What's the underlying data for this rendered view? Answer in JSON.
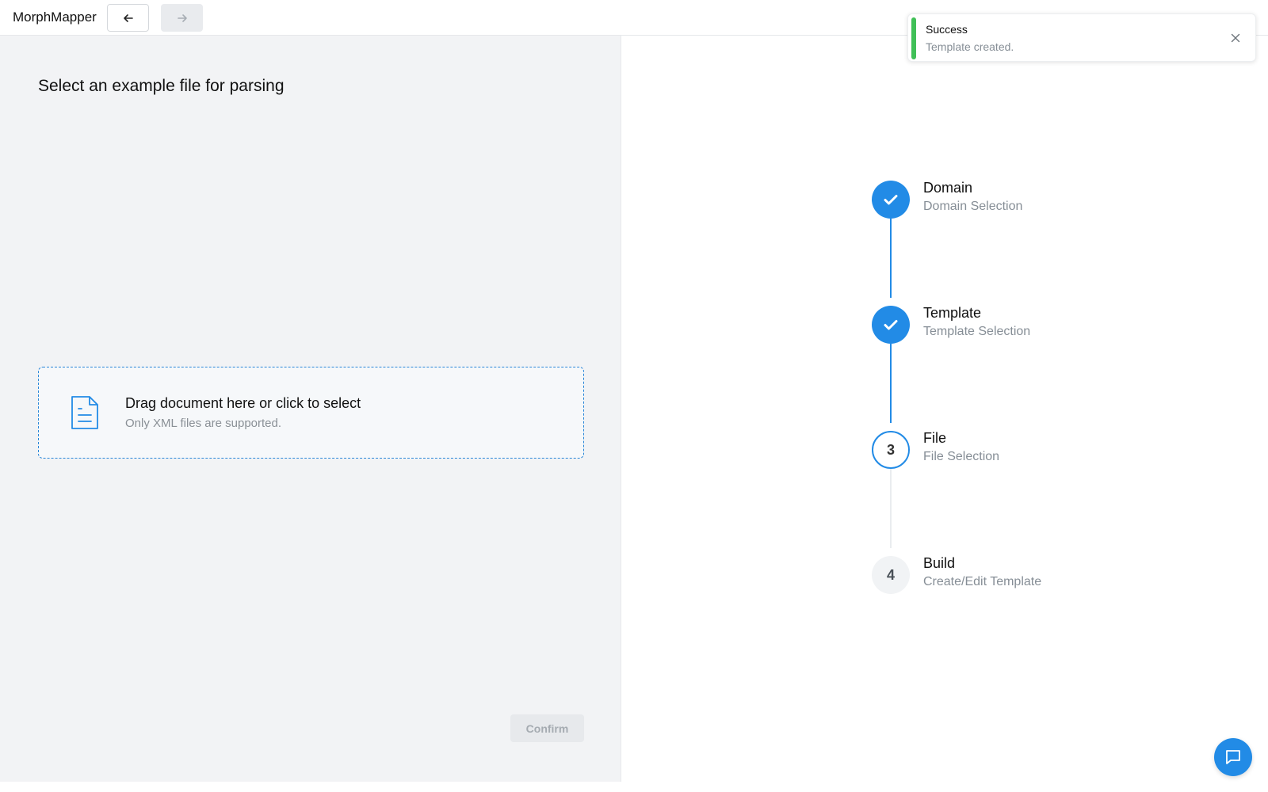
{
  "app": {
    "title": "MorphMapper"
  },
  "nav": {
    "back_icon": "arrow-left-icon",
    "forward_icon": "arrow-right-icon"
  },
  "left": {
    "title": "Select an example file for parsing",
    "dropzone": {
      "icon": "file-text-icon",
      "title": "Drag document here or click to select",
      "subtitle": "Only XML files are supported."
    },
    "confirm_label": "Confirm"
  },
  "stepper": {
    "steps": [
      {
        "label": "Domain",
        "description": "Domain Selection",
        "state": "completed",
        "indicator": "check-icon"
      },
      {
        "label": "Template",
        "description": "Template Selection",
        "state": "completed",
        "indicator": "check-icon"
      },
      {
        "label": "File",
        "description": "File Selection",
        "state": "active",
        "indicator": "3"
      },
      {
        "label": "Build",
        "description": "Create/Edit Template",
        "state": "pending",
        "indicator": "4"
      }
    ]
  },
  "toast": {
    "title": "Success",
    "message": "Template created.",
    "accent": "#40c057"
  },
  "chat": {
    "icon": "chat-bubble-icon"
  },
  "colors": {
    "primary": "#228be6",
    "success": "#40c057",
    "panel_bg": "#f2f3f5"
  }
}
